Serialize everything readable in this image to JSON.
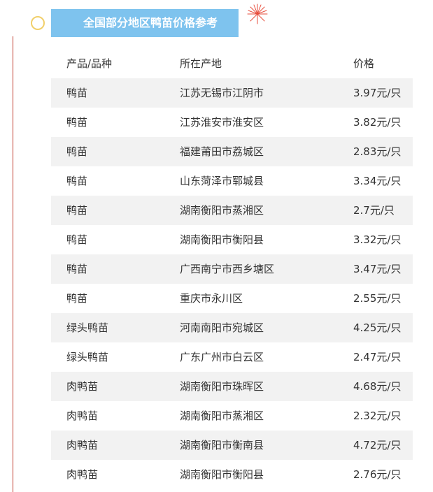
{
  "banner": {
    "title": "全国部分地区鸭苗价格参考"
  },
  "colors": {
    "banner_bg": "#7ec3ee",
    "banner_text": "#ffffff",
    "row_shade": "#f2f2f2",
    "left_line": "#c0392b",
    "circle": "#f1cf6a",
    "sparkle": "#e74c3c"
  },
  "icons": {
    "sparkle": "sparkle-icon",
    "circle": "circle-ornament"
  },
  "table": {
    "headers": [
      "产品/品种",
      "所在产地",
      "价格"
    ],
    "rows": [
      [
        "鸭苗",
        "江苏无锡市江阴市",
        "3.97元/只"
      ],
      [
        "鸭苗",
        "江苏淮安市淮安区",
        "3.82元/只"
      ],
      [
        "鸭苗",
        "福建莆田市荔城区",
        "2.83元/只"
      ],
      [
        "鸭苗",
        "山东菏泽市郓城县",
        "3.34元/只"
      ],
      [
        "鸭苗",
        "湖南衡阳市蒸湘区",
        "2.7元/只"
      ],
      [
        "鸭苗",
        "湖南衡阳市衡阳县",
        "3.32元/只"
      ],
      [
        "鸭苗",
        "广西南宁市西乡塘区",
        "3.47元/只"
      ],
      [
        "鸭苗",
        "重庆市永川区",
        "2.55元/只"
      ],
      [
        "绿头鸭苗",
        "河南南阳市宛城区",
        "4.25元/只"
      ],
      [
        "绿头鸭苗",
        "广东广州市白云区",
        "2.47元/只"
      ],
      [
        "肉鸭苗",
        "湖南衡阳市珠晖区",
        "4.68元/只"
      ],
      [
        "肉鸭苗",
        "湖南衡阳市蒸湘区",
        "2.32元/只"
      ],
      [
        "肉鸭苗",
        "湖南衡阳市衡南县",
        "4.72元/只"
      ],
      [
        "肉鸭苗",
        "湖南衡阳市衡阳县",
        "2.76元/只"
      ]
    ]
  }
}
